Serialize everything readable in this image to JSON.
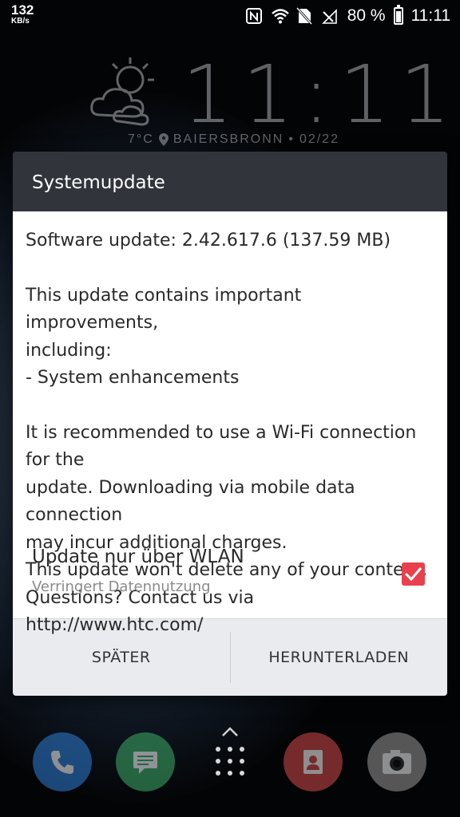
{
  "status_bar": {
    "net_speed": "132",
    "net_speed_unit": "KB/s",
    "battery_percent": "80 %",
    "time": "11:11",
    "icons": [
      "nfc-icon",
      "wifi-icon",
      "no-sim-icon",
      "signal-icon",
      "battery-icon"
    ]
  },
  "widget": {
    "clock": "11:11",
    "temperature": "7°C",
    "location": "BAIERSBRONN",
    "separator": "•",
    "date": "02/22"
  },
  "dialog": {
    "title": "Systemupdate",
    "version_line": "Software update: 2.42.617.6 (137.59 MB)",
    "description": "This update contains important improvements,\nincluding:\n- System enhancements",
    "note": "It is recommended to use a Wi-Fi connection for the\nupdate. Downloading via mobile data connection\nmay incur additional charges.\nThis update won't delete any of your content.\nQuestions? Contact us via http://www.htc.com/",
    "option": {
      "title": "Update nur über WLAN",
      "subtitle": "Verringert Datennutzung",
      "checked": true
    },
    "buttons": {
      "later": "SPÄTER",
      "download": "HERUNTERLADEN"
    }
  },
  "colors": {
    "dialog_header": "#31353b",
    "checkbox_accent": "#e8414d",
    "actions_bg": "#e9ebee"
  },
  "dock": {
    "apps": [
      "phone-icon",
      "messages-icon",
      "app-drawer-icon",
      "contacts-icon",
      "camera-icon"
    ]
  }
}
